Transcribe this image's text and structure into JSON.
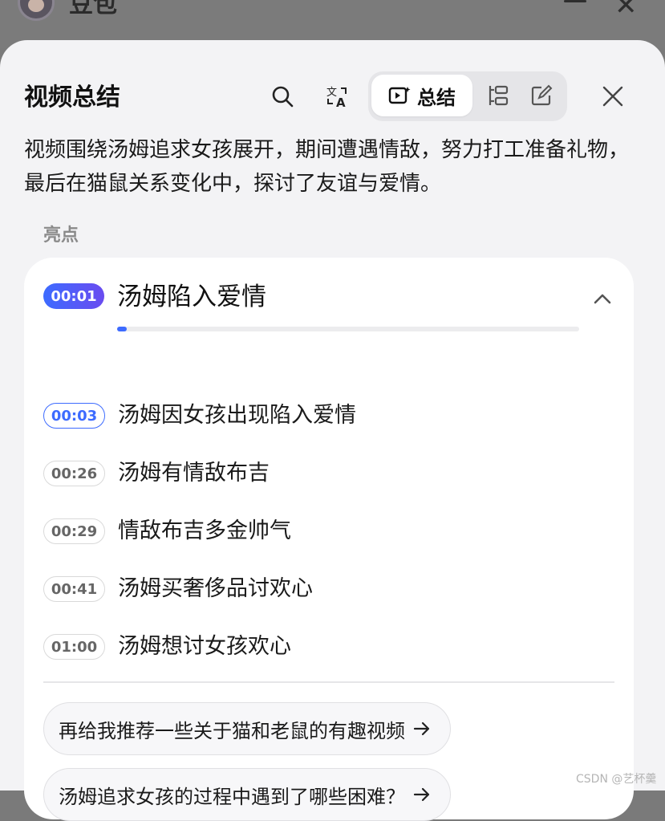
{
  "app": {
    "title": "豆包"
  },
  "panel": {
    "title": "视频总结",
    "tabs": {
      "active_label": "总结"
    },
    "summary": "视频围绕汤姆追求女孩展开，期间遭遇情敌，努力打工准备礼物，最后在猫鼠关系变化中，探讨了友谊与爱情。",
    "highlights_label": "亮点",
    "chapter": {
      "time": "00:01",
      "title": "汤姆陷入爱情",
      "progress": 0.02
    },
    "items": [
      {
        "time": "00:03",
        "text": "汤姆因女孩出现陷入爱情"
      },
      {
        "time": "00:26",
        "text": "汤姆有情敌布吉"
      },
      {
        "time": "00:29",
        "text": "情敌布吉多金帅气"
      },
      {
        "time": "00:41",
        "text": "汤姆买奢侈品讨欢心"
      },
      {
        "time": "01:00",
        "text": "汤姆想讨女孩欢心"
      }
    ],
    "suggestions": [
      "再给我推荐一些关于猫和老鼠的有趣视频",
      "汤姆追求女孩的过程中遇到了哪些困难？"
    ]
  },
  "watermark": "CSDN @艺杯羹",
  "colors": {
    "accent": "#3d6bff",
    "panel_bg": "#f3f3f5",
    "card_bg": "#ffffff"
  }
}
